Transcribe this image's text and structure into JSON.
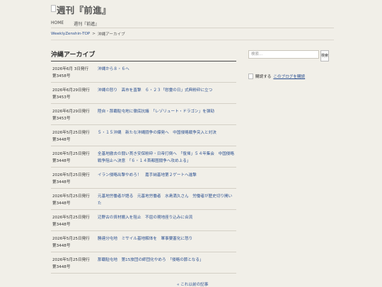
{
  "site": {
    "title": "週刊『前進』"
  },
  "nav": {
    "items": [
      "HOME",
      "週刊『前進』"
    ]
  },
  "breadcrumb": {
    "home": "WeeklyZenshin-TOP",
    "sep": ">",
    "current": "沖縄アーカイブ"
  },
  "main": {
    "title": "沖縄アーカイブ",
    "items": [
      {
        "date": "2026年6月 3日発行",
        "issue": "第3458号",
        "title": "沖縄から８・６へ"
      },
      {
        "date": "2026年6月29日発行",
        "issue": "第3453号",
        "title": "沖縄の怒り　高市を直撃　６・２３「慰霊の日」式典粉砕に立つ"
      },
      {
        "date": "2026年6月29日発行",
        "issue": "第3453号",
        "title": "陸自・那覇駐屯地に徹底抗議　「レゾリュート・ドラゴン」を弾劾"
      },
      {
        "date": "2026年5月25日発行",
        "issue": "第3448号",
        "title": "５・１５沖縄　新たな沖縄闘争の爆発へ　中国侵略戦争突入と対決"
      },
      {
        "date": "2026年5月25日発行",
        "issue": "第3448号",
        "title": "全基地撤去の闘い貫き安保粉砕・日帝打倒へ　「復帰」５４年集会　中国侵略戦争阻止へ決意　「６・１４首都圏闘争へ攻め上る」"
      },
      {
        "date": "2026年5月25日発行",
        "issue": "第3448号",
        "title": "イラン侵略出撃やめろ！　嘉手納基地第２ゲートへ進撃"
      },
      {
        "date": "2026年5月25日発行",
        "issue": "第3448号",
        "title": "元基地労働者が語る　元基地労働者　水島満久さん　労働者が歴史切り開いた"
      },
      {
        "date": "2026年5月25日発行",
        "issue": "第3448号",
        "title": "辺野古の資材搬入を阻止　不屈の現地座り込みに合流"
      },
      {
        "date": "2026年5月25日発行",
        "issue": "第3448号",
        "title": "勝連分屯地　ミサイル基地解体を　軍事要塞化に怒り"
      },
      {
        "date": "2026年5月25日発行",
        "issue": "第3448号",
        "title": "那覇駐屯地　第15旅団の師団化やめろ　「侵略の節となる」"
      }
    ],
    "older_link": "« これ以前の記事"
  },
  "sidebar": {
    "search_placeholder": "検索...",
    "search_button": "検索",
    "subscribe_label": "購読する",
    "subscribe_link": "このブログを購読"
  }
}
